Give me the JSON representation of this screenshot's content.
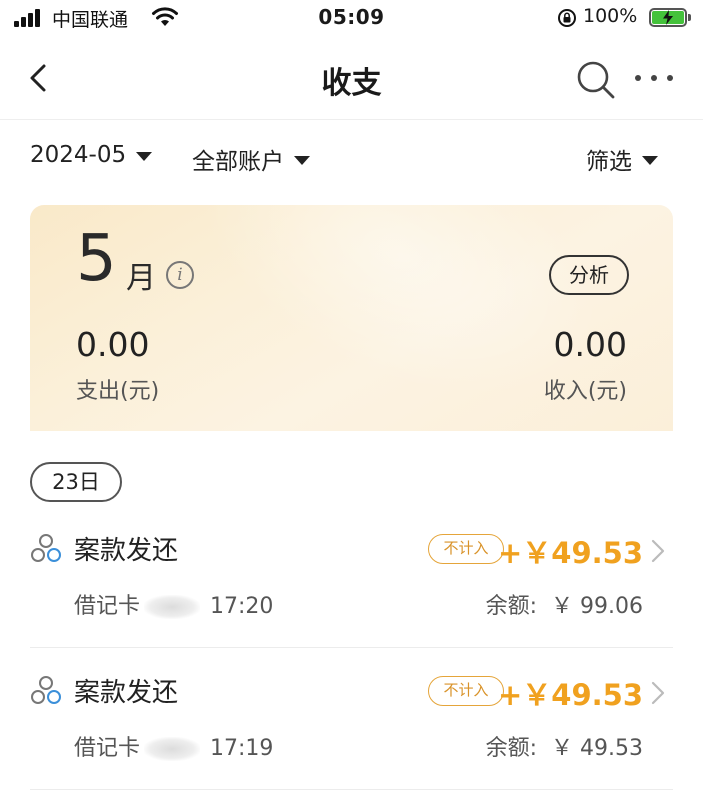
{
  "status_bar": {
    "carrier": "中国联通",
    "time": "05:09",
    "battery": "100%"
  },
  "nav": {
    "title": "收支"
  },
  "filters": {
    "month": "2024-05",
    "account": "全部账户",
    "filter": "筛选"
  },
  "summary": {
    "month_number": "5",
    "month_suffix": "月",
    "info_glyph": "i",
    "analysis_label": "分析",
    "expense_amount": "0.00",
    "expense_label": "支出(元)",
    "income_amount": "0.00",
    "income_label": "收入(元)"
  },
  "day_label": "23日",
  "transactions": [
    {
      "title": "案款发还",
      "tag": "不计入",
      "amount": "+￥49.53",
      "account_prefix": "借记卡",
      "time": "17:20",
      "balance_label": "余额:",
      "balance": "￥ 99.06"
    },
    {
      "title": "案款发还",
      "tag": "不计入",
      "amount": "+￥49.53",
      "account_prefix": "借记卡",
      "time": "17:19",
      "balance_label": "余额:",
      "balance": "￥ 49.53"
    }
  ],
  "colors": {
    "accent_amount": "#f0a11f",
    "tag_border": "#e5a53a",
    "card_bg": "#fbf0d9",
    "battery_fill": "#44c23b"
  },
  "icons": {
    "back": "chevron-left-icon",
    "search": "search-icon",
    "more": "more-dots-icon",
    "info": "info-icon",
    "transaction": "category-icon",
    "detail": "chevron-right-icon"
  }
}
